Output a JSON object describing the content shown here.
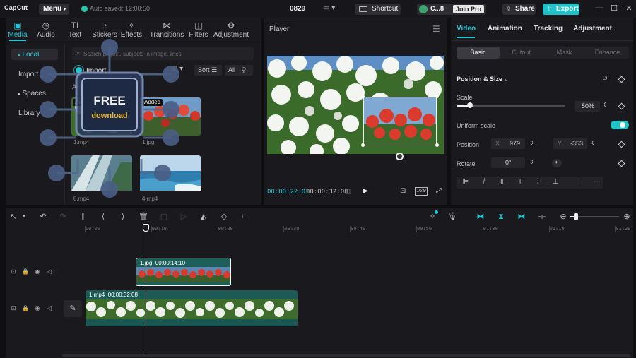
{
  "titlebar": {
    "logo": "CapCut",
    "menu_label": "Menu",
    "autosave": "Auto saved: 12:00:50",
    "project_name": "0829",
    "shortcut_label": "Shortcut",
    "account_name": "C...8",
    "joinpro_label": "Join Pro",
    "share_label": "Share",
    "export_label": "Export"
  },
  "media_tabs": [
    {
      "label": "Media",
      "icon": "media-icon",
      "glyph": "▣"
    },
    {
      "label": "Audio",
      "icon": "audio-icon",
      "glyph": "◷"
    },
    {
      "label": "Text",
      "icon": "text-icon",
      "glyph": "TI"
    },
    {
      "label": "Stickers",
      "icon": "stickers-icon",
      "glyph": "◔"
    },
    {
      "label": "Effects",
      "icon": "effects-icon",
      "glyph": "✧"
    },
    {
      "label": "Transitions",
      "icon": "transitions-icon",
      "glyph": "⋈"
    },
    {
      "label": "Filters",
      "icon": "filters-icon",
      "glyph": "◫"
    },
    {
      "label": "Adjustment",
      "icon": "adjustment-icon",
      "glyph": "⚙"
    }
  ],
  "side_nav": [
    "Local",
    "Import",
    "Spaces",
    "Library"
  ],
  "media": {
    "search_placeholder": "Search project, subjects in image, lines",
    "import_label": "Import",
    "sort_label": "Sort",
    "all_filter": "All",
    "all_label": "All",
    "added_badge": "Added",
    "items": [
      "1.mp4",
      "1.jpg",
      "8.mp4",
      "4.mp4"
    ]
  },
  "watermark": {
    "line1": "FREE",
    "line2": "download"
  },
  "player": {
    "title": "Player",
    "time_current": "00:00:22:01",
    "time_total": "00:00:32:08",
    "ratio": "16:9"
  },
  "right_tabs": [
    "Video",
    "Animation",
    "Tracking",
    "Adjustment"
  ],
  "sub_tabs": [
    "Basic",
    "Cutout",
    "Mask",
    "Enhance"
  ],
  "properties": {
    "section_title": "Position & Size",
    "scale_label": "Scale",
    "scale_value": "50%",
    "scale_percent": 50,
    "uniform_label": "Uniform scale",
    "position_label": "Position",
    "x_axis": "X",
    "x_value": "979",
    "y_axis": "Y",
    "y_value": "-353",
    "rotate_label": "Rotate",
    "rotate_value": "0°"
  },
  "ruler_ticks": [
    "00:00",
    "00:10",
    "00:20",
    "00:30",
    "00:40",
    "00:50",
    "01:00",
    "01:10",
    "01:20"
  ],
  "clips": {
    "overlay": {
      "name": "1.jpg",
      "duration": "00:00:14:10"
    },
    "main": {
      "name": "1.mp4",
      "duration": "00:00:32:08"
    }
  }
}
